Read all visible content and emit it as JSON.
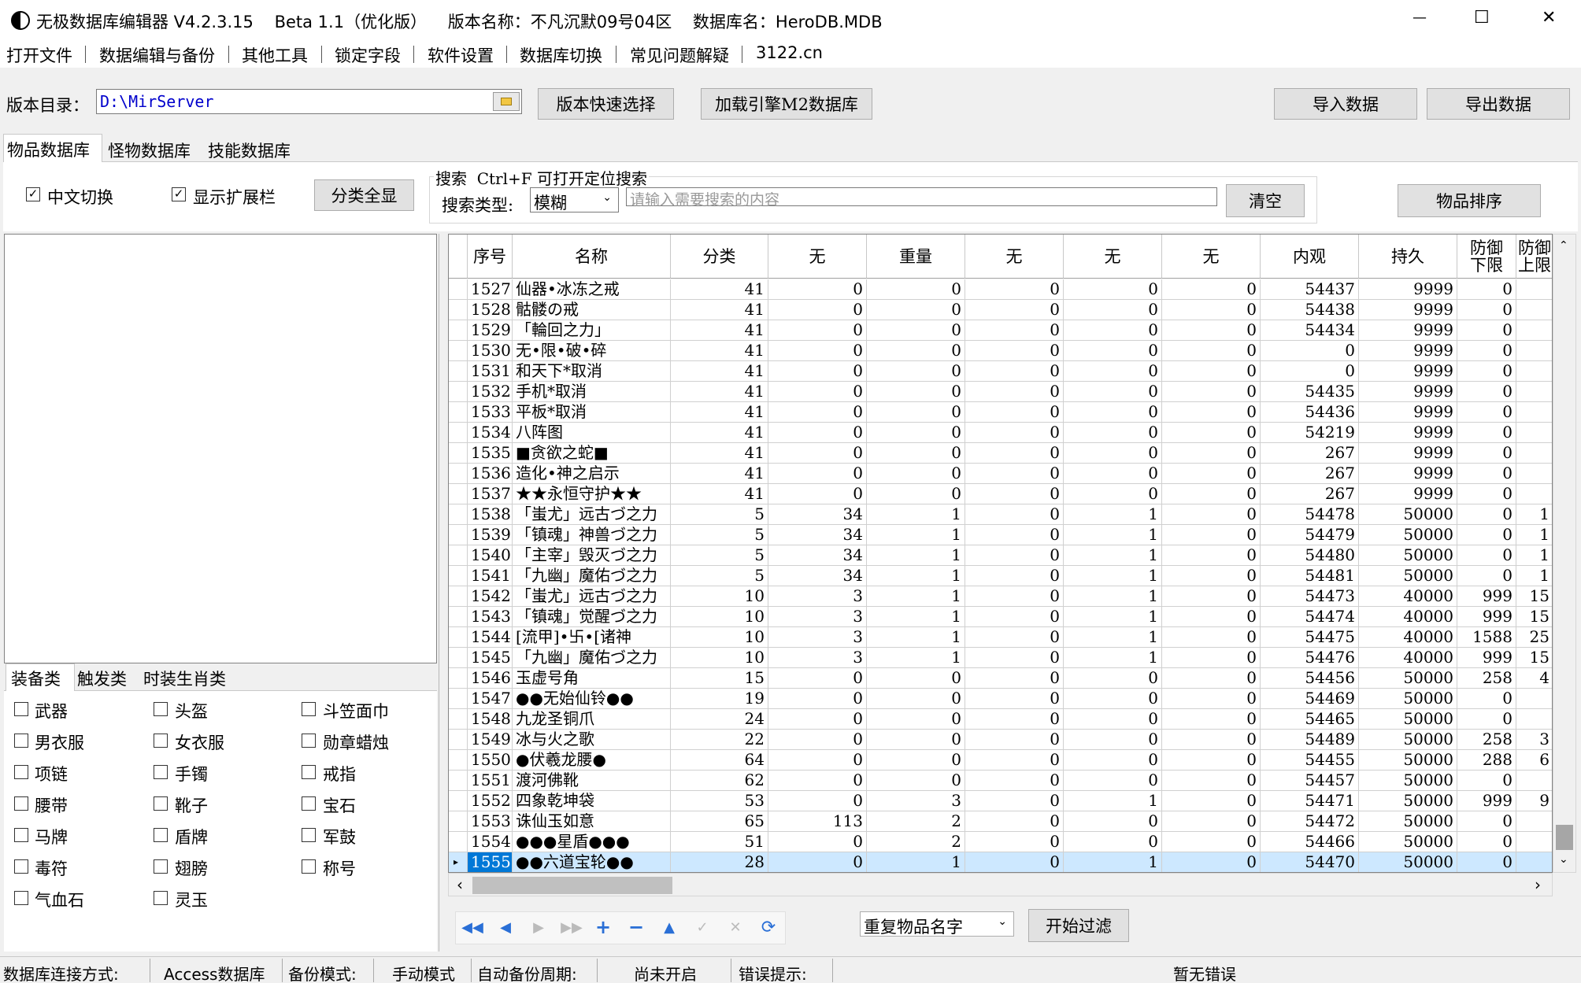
{
  "title_bar": {
    "title": "无极数据库编辑器 V4.2.3.15    Beta 1.1（优化版）    版本名称：不凡沉默09号04区    数据库名：HeroDB.MDB",
    "min_glyph": "—",
    "max_glyph": "☐",
    "close_glyph": "✕"
  },
  "menu": [
    "打开文件",
    "数据编辑与备份",
    "其他工具",
    "锁定字段",
    "软件设置",
    "数据库切换",
    "常见问题解疑",
    "3122.cn"
  ],
  "toolbar": {
    "dir_label": "版本目录：",
    "dir_value": "D:\\MirServer",
    "quick_select": "版本快速选择",
    "load_m2": "加载引擎M2数据库",
    "import": "导入数据",
    "export": "导出数据"
  },
  "main_tabs": [
    "物品数据库",
    "怪物数据库",
    "技能数据库"
  ],
  "options": {
    "chinese_switch": "中文切换",
    "show_ext": "显示扩展栏",
    "show_all": "分类全显",
    "check_mark": "✓"
  },
  "search": {
    "title": "搜索  Ctrl+F 可打开定位搜索",
    "type_label": "搜索类型:",
    "type_value": "模糊",
    "placeholder": "请输入需要搜索的内容",
    "clear": "清空",
    "sort": "物品排序"
  },
  "category_tabs": [
    "装备类",
    "触发类",
    "时装生肖类"
  ],
  "categories": [
    [
      "武器",
      "头盔",
      "斗笠面巾"
    ],
    [
      "男衣服",
      "女衣服",
      "勋章蜡烛"
    ],
    [
      "项链",
      "手镯",
      "戒指"
    ],
    [
      "腰带",
      "靴子",
      "宝石"
    ],
    [
      "马牌",
      "盾牌",
      "军鼓"
    ],
    [
      "毒符",
      "翅膀",
      "称号"
    ],
    [
      "气血石",
      "灵玉",
      ""
    ]
  ],
  "grid": {
    "headers": [
      "序号",
      "名称",
      "分类",
      "无",
      "重量",
      "无",
      "无",
      "无",
      "内观",
      "持久",
      "防御\n下限",
      "防御\n上限"
    ],
    "rows": [
      [
        "1527",
        "仙器•冰冻之戒",
        "41",
        "0",
        "0",
        "0",
        "0",
        "0",
        "54437",
        "9999",
        "0",
        ""
      ],
      [
        "1528",
        "骷髅の戒",
        "41",
        "0",
        "0",
        "0",
        "0",
        "0",
        "54438",
        "9999",
        "0",
        ""
      ],
      [
        "1529",
        "「輪回之力」",
        "41",
        "0",
        "0",
        "0",
        "0",
        "0",
        "54434",
        "9999",
        "0",
        ""
      ],
      [
        "1530",
        "无•限•破•碎",
        "41",
        "0",
        "0",
        "0",
        "0",
        "0",
        "0",
        "9999",
        "0",
        ""
      ],
      [
        "1531",
        "和天下*取消",
        "41",
        "0",
        "0",
        "0",
        "0",
        "0",
        "0",
        "9999",
        "0",
        ""
      ],
      [
        "1532",
        "手机*取消",
        "41",
        "0",
        "0",
        "0",
        "0",
        "0",
        "54435",
        "9999",
        "0",
        ""
      ],
      [
        "1533",
        "平板*取消",
        "41",
        "0",
        "0",
        "0",
        "0",
        "0",
        "54436",
        "9999",
        "0",
        ""
      ],
      [
        "1534",
        "八阵图",
        "41",
        "0",
        "0",
        "0",
        "0",
        "0",
        "54219",
        "9999",
        "0",
        ""
      ],
      [
        "1535",
        "■贪欲之蛇■",
        "41",
        "0",
        "0",
        "0",
        "0",
        "0",
        "267",
        "9999",
        "0",
        ""
      ],
      [
        "1536",
        "造化•神之启示",
        "41",
        "0",
        "0",
        "0",
        "0",
        "0",
        "267",
        "9999",
        "0",
        ""
      ],
      [
        "1537",
        "★★永恒守护★★",
        "41",
        "0",
        "0",
        "0",
        "0",
        "0",
        "267",
        "9999",
        "0",
        ""
      ],
      [
        "1538",
        "「蚩尤」远古づ之力",
        "5",
        "34",
        "1",
        "0",
        "1",
        "0",
        "54478",
        "50000",
        "0",
        "1"
      ],
      [
        "1539",
        "「镇魂」神兽づ之力",
        "5",
        "34",
        "1",
        "0",
        "1",
        "0",
        "54479",
        "50000",
        "0",
        "1"
      ],
      [
        "1540",
        "「主宰」毁灭づ之力",
        "5",
        "34",
        "1",
        "0",
        "1",
        "0",
        "54480",
        "50000",
        "0",
        "1"
      ],
      [
        "1541",
        "「九幽」魔佑づ之力",
        "5",
        "34",
        "1",
        "0",
        "1",
        "0",
        "54481",
        "50000",
        "0",
        "1"
      ],
      [
        "1542",
        "「蚩尤」远古づ之力",
        "10",
        "3",
        "1",
        "0",
        "1",
        "0",
        "54473",
        "40000",
        "999",
        "15"
      ],
      [
        "1543",
        "「镇魂」觉醒づ之力",
        "10",
        "3",
        "1",
        "0",
        "1",
        "0",
        "54474",
        "40000",
        "999",
        "15"
      ],
      [
        "1544",
        "[流甲]•卐•[诸神",
        "10",
        "3",
        "1",
        "0",
        "1",
        "0",
        "54475",
        "40000",
        "1588",
        "25"
      ],
      [
        "1545",
        "「九幽」魔佑づ之力",
        "10",
        "3",
        "1",
        "0",
        "1",
        "0",
        "54476",
        "40000",
        "999",
        "15"
      ],
      [
        "1546",
        "玉虚号角",
        "15",
        "0",
        "0",
        "0",
        "0",
        "0",
        "54456",
        "50000",
        "258",
        "4"
      ],
      [
        "1547",
        "●●无始仙铃●●",
        "19",
        "0",
        "0",
        "0",
        "0",
        "0",
        "54469",
        "50000",
        "0",
        ""
      ],
      [
        "1548",
        "九龙圣铜爪",
        "24",
        "0",
        "0",
        "0",
        "0",
        "0",
        "54465",
        "50000",
        "0",
        ""
      ],
      [
        "1549",
        "冰与火之歌",
        "22",
        "0",
        "0",
        "0",
        "0",
        "0",
        "54489",
        "50000",
        "258",
        "3"
      ],
      [
        "1550",
        "●伏羲龙腰●",
        "64",
        "0",
        "0",
        "0",
        "0",
        "0",
        "54455",
        "50000",
        "288",
        "6"
      ],
      [
        "1551",
        "渡河佛靴",
        "62",
        "0",
        "0",
        "0",
        "0",
        "0",
        "54457",
        "50000",
        "0",
        ""
      ],
      [
        "1552",
        "四象乾坤袋",
        "53",
        "0",
        "3",
        "0",
        "1",
        "0",
        "54471",
        "50000",
        "999",
        "9"
      ],
      [
        "1553",
        "诛仙玉如意",
        "65",
        "113",
        "2",
        "0",
        "0",
        "0",
        "54472",
        "50000",
        "0",
        ""
      ],
      [
        "1554",
        "●●●星盾●●●",
        "51",
        "0",
        "2",
        "0",
        "0",
        "0",
        "54466",
        "50000",
        "0",
        ""
      ],
      [
        "1555",
        "●●六道宝轮●●",
        "28",
        "0",
        "1",
        "0",
        "1",
        "0",
        "54470",
        "50000",
        "0",
        ""
      ]
    ]
  },
  "filter": {
    "select_value": "重复物品名字",
    "start": "开始过滤"
  },
  "status": {
    "conn_label": "数据库连接方式:",
    "conn_value": "Access数据库",
    "backup_label": "备份模式:",
    "backup_value": "手动模式",
    "auto_label": "自动备份周期:",
    "auto_value": "尚未开启",
    "error_label": "错误提示:",
    "error_value": "暂无错误"
  },
  "colors": {
    "selected_row": "#cde8ff",
    "selected_id": "#0078d7",
    "path_text": "#0000cc",
    "nav_blue": "#2a6fd6"
  }
}
